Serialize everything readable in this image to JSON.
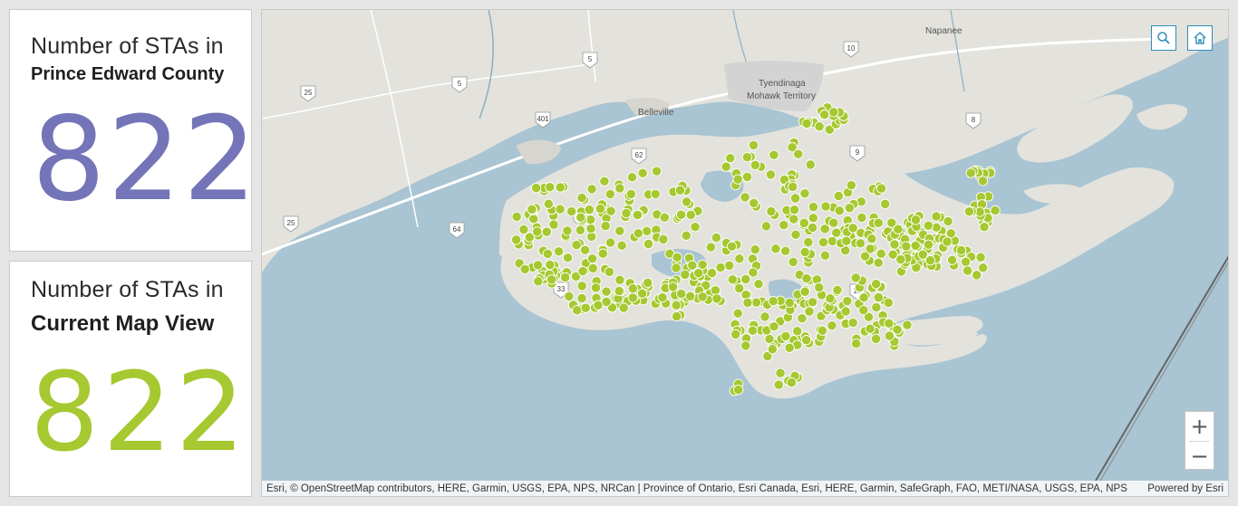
{
  "cards": [
    {
      "title": "Number of STAs in",
      "subtitle": "Prince Edward County",
      "value": "822",
      "color": "#7474b8"
    },
    {
      "title": "Number of STAs in",
      "subtitle": "Current Map View",
      "value": "822",
      "color": "#a6c830"
    }
  ],
  "map": {
    "place_labels": [
      "Napanee",
      "Belleville",
      "Tyendinaga",
      "Mohawk Territory"
    ],
    "route_shields": [
      "10",
      "5",
      "5",
      "25",
      "401",
      "62",
      "8",
      "9",
      "19",
      "25",
      "64",
      "33",
      "17"
    ],
    "buttons": {
      "search_icon": "search-icon",
      "home_icon": "home-icon"
    },
    "zoom": {
      "in": "+",
      "out": "−"
    },
    "attribution": "Esri, © OpenStreetMap contributors, HERE, Garmin, USGS, EPA, NPS, NRCan | Province of Ontario, Esri Canada, Esri, HERE, Garmin, SafeGraph, FAO, METI/NASA, USGS, EPA, NPS",
    "powered_by": "Powered by Esri",
    "marker_color": "#a6c830",
    "water_color": "#a9c4d2",
    "land_color": "#e3e2dc"
  }
}
